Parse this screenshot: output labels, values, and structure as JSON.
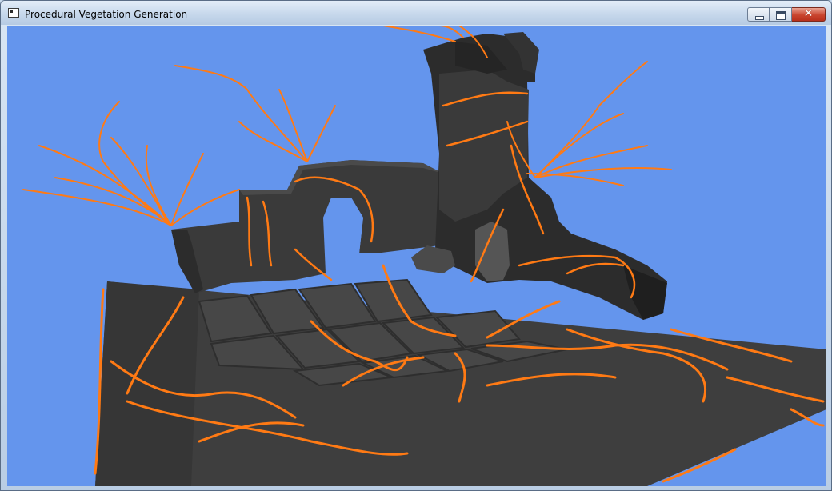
{
  "window": {
    "title": "Procedural Vegetation Generation",
    "buttons": {
      "minimize": "minimize-icon",
      "maximize": "maximize-icon",
      "close": "close-icon",
      "close_glyph": "✕"
    }
  },
  "scene": {
    "sky_color": "#6495ed",
    "ground_color": "#3c3c3c",
    "stone_color": "#303030",
    "vine_color": "#ff7a14"
  }
}
